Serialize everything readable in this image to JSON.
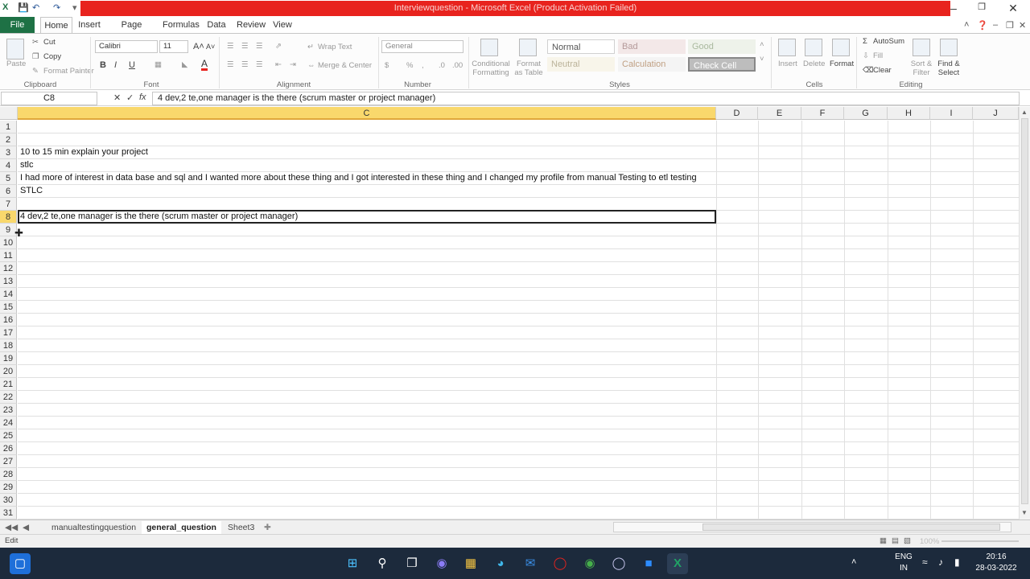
{
  "titlebar": {
    "title": "Interviewquestion - Microsoft Excel (Product Activation Failed)"
  },
  "tabs": [
    "File",
    "Home",
    "Insert",
    "Page Layout",
    "Formulas",
    "Data",
    "Review",
    "View"
  ],
  "ribbon": {
    "clipboard": {
      "paste": "Paste",
      "cut": "Cut",
      "copy": "Copy",
      "format_painter": "Format Painter",
      "label": "Clipboard"
    },
    "font": {
      "name": "Calibri",
      "size": "11",
      "bold": "B",
      "italic": "I",
      "underline": "U",
      "label": "Font"
    },
    "alignment": {
      "wrap_text": "Wrap Text",
      "merge_center": "Merge & Center",
      "label": "Alignment"
    },
    "number": {
      "format": "General",
      "label": "Number"
    },
    "styles": {
      "conditional": "Conditional Formatting",
      "format_table": "Format as Table",
      "normal": "Normal",
      "bad": "Bad",
      "good": "Good",
      "neutral": "Neutral",
      "calculation": "Calculation",
      "check_cell": "Check Cell",
      "label": "Styles"
    },
    "cells": {
      "insert": "Insert",
      "delete": "Delete",
      "format": "Format",
      "label": "Cells"
    },
    "editing": {
      "autosum": "AutoSum",
      "fill": "Fill",
      "clear": "Clear",
      "sort_filter": "Sort & Filter",
      "find_select": "Find & Select",
      "label": "Editing"
    }
  },
  "formula_bar": {
    "name_box": "C8",
    "fx": "fx",
    "content": "4 dev,2 te,one manager is the there (scrum master or project manager)"
  },
  "columns": [
    "C",
    "D",
    "E",
    "F",
    "G",
    "H",
    "I",
    "J"
  ],
  "rows": [
    "1",
    "2",
    "3",
    "4",
    "5",
    "6",
    "7",
    "8",
    "9",
    "10",
    "11",
    "12",
    "13",
    "14",
    "15",
    "16",
    "17",
    "18",
    "19",
    "20",
    "21",
    "22",
    "23",
    "24",
    "25",
    "26",
    "27",
    "28",
    "29",
    "30",
    "31"
  ],
  "cells": {
    "r3": "10 to 15 min explain your project",
    "r4": "stlc",
    "r5": "I had more of interest in data base and sql and I wanted more about these thing and I got interested in these thing and I changed my profile from manual Testing to etl testing",
    "r6": "STLC",
    "r8": "4 dev,2 te,one manager is the there (scrum master or project manager)"
  },
  "sheets": [
    "manualtestingquestion",
    "general_question",
    "Sheet3"
  ],
  "status": {
    "mode": "Edit",
    "zoom": "100%"
  },
  "taskbar": {
    "lang": "ENG",
    "region": "IN",
    "time": "20:16",
    "date": "28-03-2022"
  }
}
